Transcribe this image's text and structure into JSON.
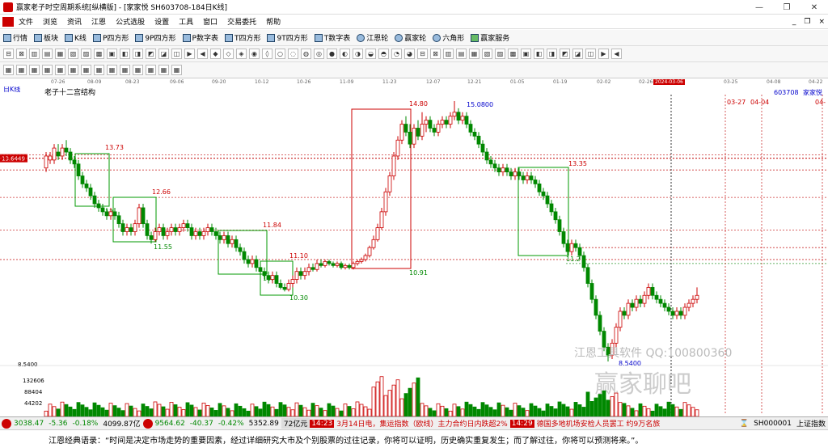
{
  "window": {
    "title": "赢家老子时空周期系统[纵横版] - [家家悦  SH603708-184日K线]",
    "controls": [
      "—",
      "❐",
      "✕"
    ]
  },
  "menu": {
    "items": [
      "文件",
      "浏览",
      "资讯",
      "江恩",
      "公式选股",
      "设置",
      "工具",
      "窗口",
      "交易委托",
      "帮助"
    ],
    "mdi": [
      "_",
      "❐",
      "×"
    ]
  },
  "toolbar1": {
    "items": [
      "行情",
      "板块",
      "K线",
      "P四方形",
      "9P四方形",
      "P数字表",
      "T四方形",
      "9T四方形",
      "T数字表",
      "江恩轮",
      "赢家轮",
      "六角形",
      "赢家服务"
    ]
  },
  "datebar": {
    "dates": [
      "07-26",
      "08-09",
      "08-23",
      "09-06",
      "09-20",
      "10-12",
      "10-26",
      "11-09",
      "11-23",
      "12-07",
      "12-21",
      "01-05",
      "01-19",
      "02-02",
      "02-26",
      "03-06",
      "03-25",
      "04-08",
      "04-22"
    ],
    "selected": "2024-03-06"
  },
  "chart": {
    "period_label": "日K线",
    "indicator_label": "老子十二宫结构",
    "code_label": "603708",
    "name_label": "家家悦",
    "left_price_tag": "13.6449",
    "future_dates": [
      "03-27",
      "04-04",
      "04-"
    ],
    "price_labels": {
      "p1373": "13.73",
      "p1266": "12.66",
      "p12": "12",
      "p1155": "11.55",
      "p1184": "11.84",
      "p1110": "11.10",
      "p10": "10.",
      "p1030": "10.30",
      "p1480": "14.80",
      "p1091": "10.91",
      "p15080": "15.0800",
      "p1335": "13.35",
      "p112": "11.2",
      "p8540_left": "8.5400",
      "p8540": "8.5400"
    },
    "volume_labels": [
      "132606",
      "88404",
      "44202"
    ],
    "watermark1": "江恩工具软件  QQ:100800360",
    "watermark2": "赢家聊吧"
  },
  "status": {
    "sh_index": "3038.47",
    "sh_change": "-5.36",
    "sh_pct": "-0.18%",
    "sh_amount": "4099.87亿",
    "sz_index": "9564.62",
    "sz_change": "-40.37",
    "sz_pct": "-0.42%",
    "sz_amount": "5352.89",
    "amount2": "72亿元",
    "news1_time": "14:23",
    "news1": "3月14日电，集运指数（欧线）主力合约日内跌超2%",
    "news2_time": "14:29",
    "news2": "德国多地机场安检人员罢工 约9万名旅",
    "code": "SH000001",
    "code_name": "上证指数"
  },
  "quote": {
    "text": "江恩经典语录：“时间是决定市场走势的重要因素，经过详细研究大市及个别股票的过往记录，你将可以证明，历史确实重复发生；而了解过往，你将可以预测将来。”。"
  },
  "colors": {
    "up": "#cc0000",
    "down": "#008800",
    "box_green": "#009900",
    "box_red": "#cc0000"
  }
}
